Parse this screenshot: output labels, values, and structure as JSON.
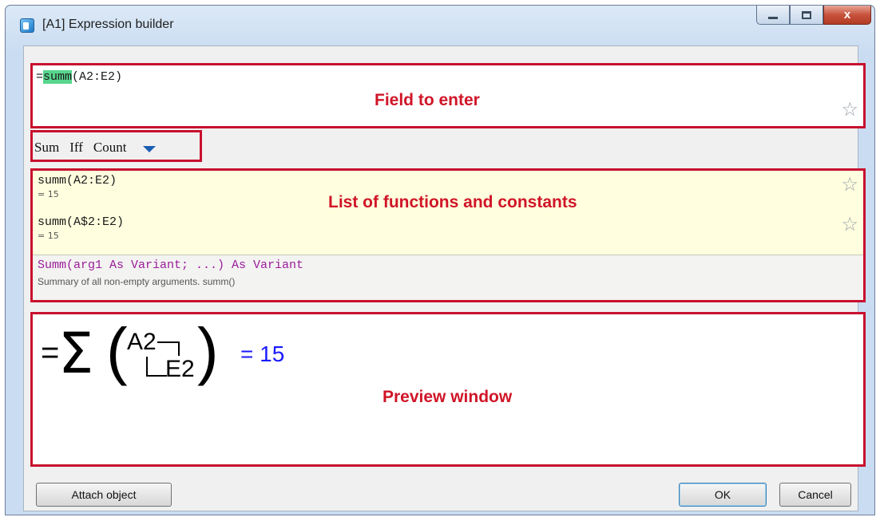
{
  "window": {
    "title": "[A1] Expression builder",
    "controls": {
      "minimize": "minimize",
      "maximize": "maximize",
      "close": "x"
    }
  },
  "expression_field": {
    "prefix": "=",
    "highlighted": "summ",
    "suffix": "(A2:E2)",
    "annotation": "Field to enter"
  },
  "quick_functions": {
    "items": [
      "Sum",
      "Iff",
      "Count"
    ]
  },
  "function_list": {
    "annotation": "List of functions and constants",
    "items": [
      {
        "expr": "summ(A2:E2)",
        "result": "= 15"
      },
      {
        "expr": "summ(A$2:E2)",
        "result": "= 15"
      }
    ],
    "description": {
      "signature": "Summ(arg1 As Variant; ...) As Variant",
      "text": "Summary of all non-empty arguments. summ()"
    }
  },
  "preview": {
    "annotation": "Preview window",
    "formula": {
      "equals": "=",
      "operator": "Σ",
      "range_start": "A2",
      "range_end": "E2",
      "result": "= 15"
    }
  },
  "buttons": {
    "attach": "Attach object",
    "ok": "OK",
    "cancel": "Cancel"
  },
  "colors": {
    "annotation": "#d01528",
    "highlight": "#58d68d",
    "signature": "#9b1c9b",
    "result": "#1a1aff",
    "list_background": "#ffffdf"
  }
}
